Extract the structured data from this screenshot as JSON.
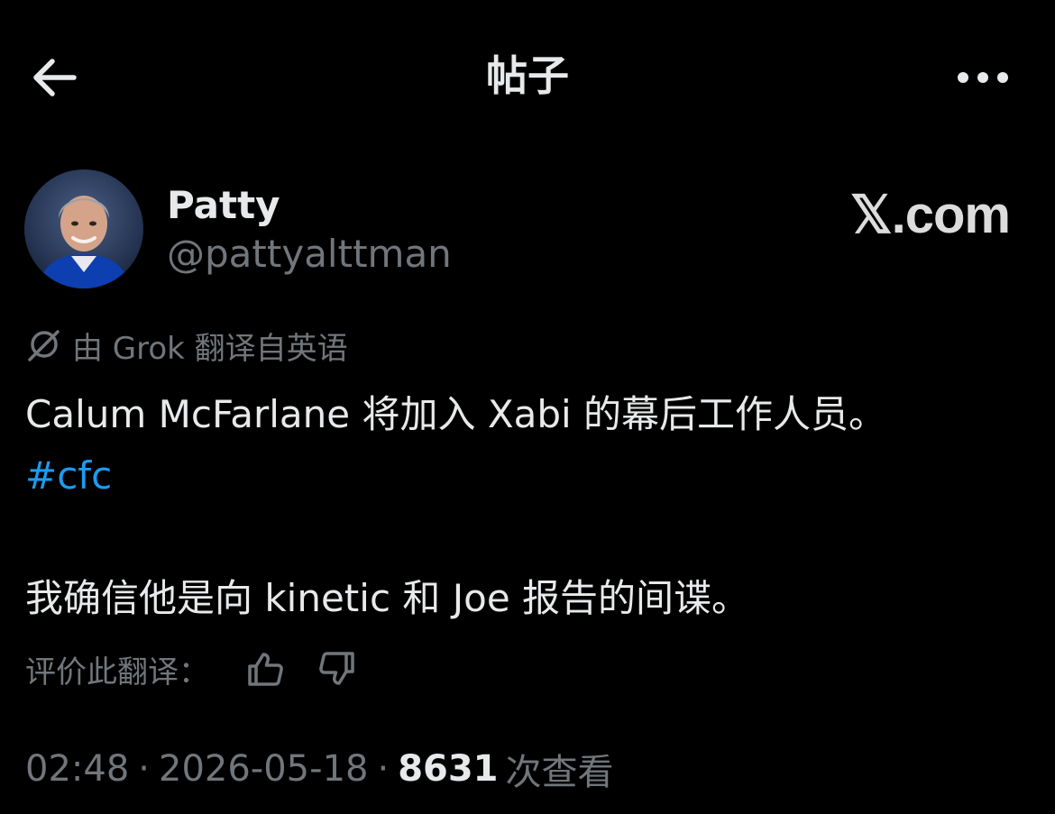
{
  "header": {
    "title": "帖子"
  },
  "author": {
    "display_name": "Patty",
    "handle": "@pattyalttman"
  },
  "watermark": "𝕏.com",
  "translation_note": "由 Grok 翻译自英语",
  "tweet": {
    "line1": "Calum McFarlane 将加入 Xabi 的幕后工作人员。",
    "hashtag": "#cfc",
    "line2": "我确信他是向 kinetic 和 Joe 报告的间谍。"
  },
  "rate_translation": {
    "label": "评价此翻译："
  },
  "meta": {
    "time": "02:48",
    "separator": "·",
    "date": "2026-05-18",
    "views_count": "8631",
    "views_label": "次查看"
  },
  "colors": {
    "background": "#000000",
    "text_primary": "#e7e9ea",
    "text_secondary": "#71767b",
    "link": "#1d9bf0"
  },
  "icons": [
    "back-arrow-icon",
    "more-icon",
    "grok-icon",
    "thumbs-up-icon",
    "thumbs-down-icon"
  ]
}
